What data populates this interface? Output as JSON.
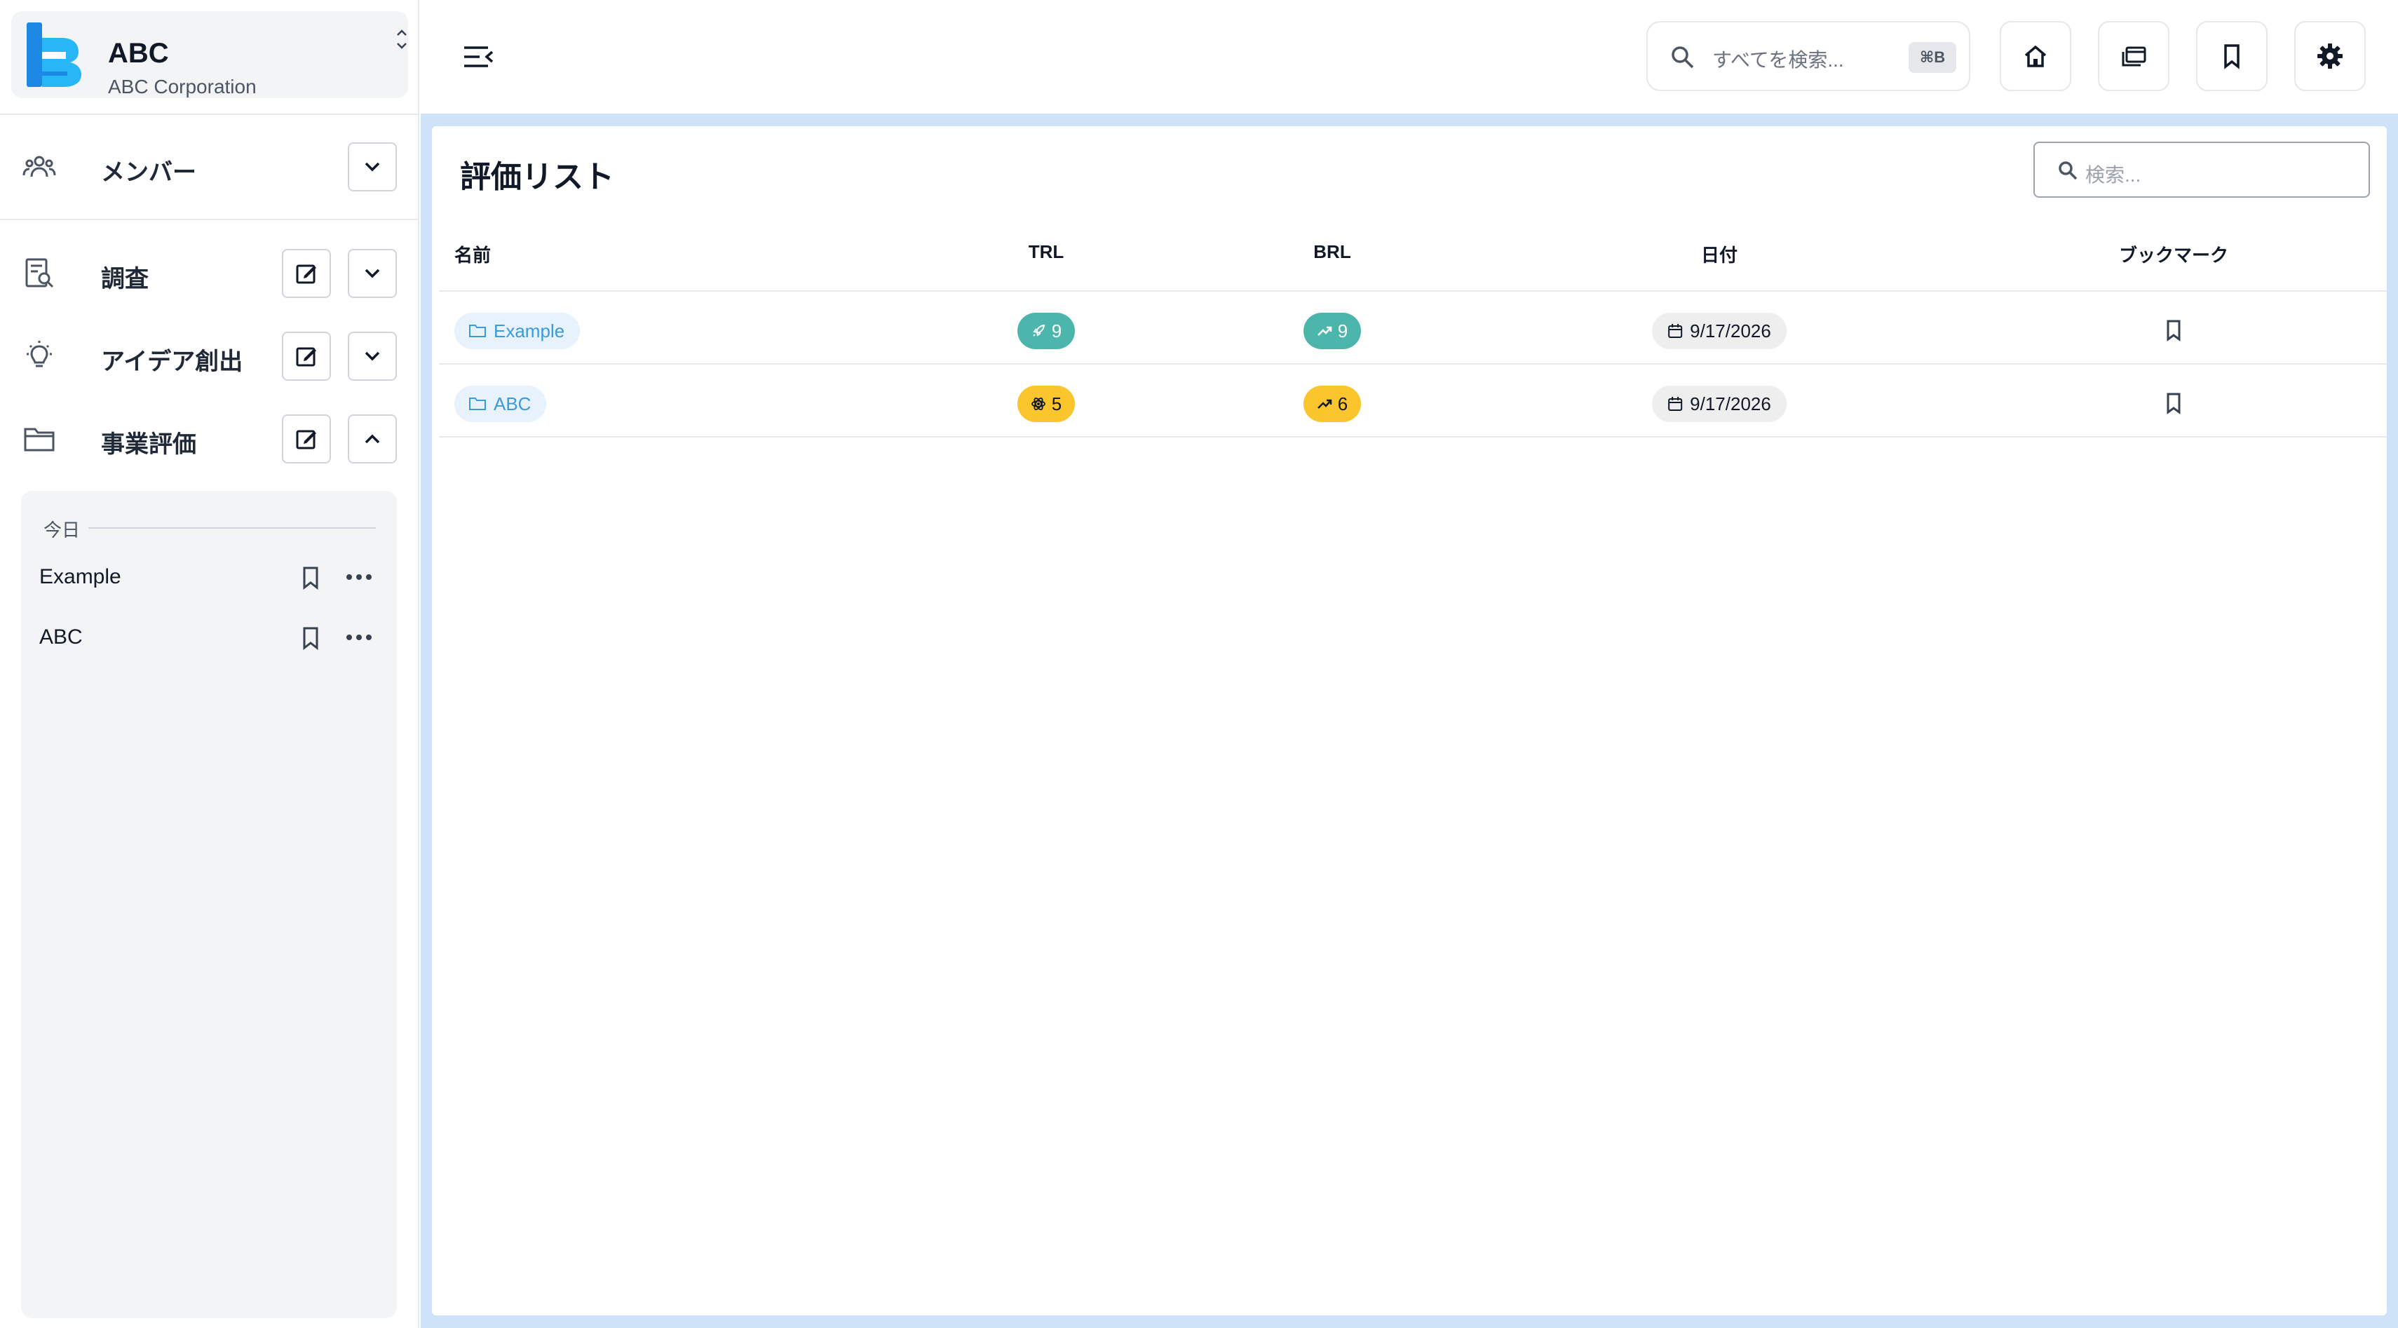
{
  "org": {
    "name": "ABC",
    "subtitle": "ABC Corporation",
    "logo_color": "#1e88e5"
  },
  "sidebar": {
    "items": [
      {
        "label": "メンバー",
        "icon": "people-icon",
        "has_edit": false,
        "expanded": false
      },
      {
        "label": "調査",
        "icon": "research-icon",
        "has_edit": true,
        "expanded": false
      },
      {
        "label": "アイデア創出",
        "icon": "lightbulb-icon",
        "has_edit": true,
        "expanded": false
      },
      {
        "label": "事業評価",
        "icon": "folder-icon",
        "has_edit": true,
        "expanded": true
      }
    ],
    "history": {
      "group_label": "今日",
      "items": [
        {
          "label": "Example"
        },
        {
          "label": "ABC"
        }
      ]
    }
  },
  "header": {
    "search_placeholder": "すべてを検索...",
    "search_shortcut": "⌘B",
    "buttons": [
      "home-icon",
      "stack-icon",
      "bookmark-icon",
      "settings-icon"
    ]
  },
  "main": {
    "title": "評価リスト",
    "search_placeholder": "検索...",
    "columns": {
      "name": "名前",
      "trl": "TRL",
      "brl": "BRL",
      "date": "日付",
      "bookmark": "ブックマーク"
    },
    "rows": [
      {
        "name": "Example",
        "trl": "9",
        "trl_icon": "rocket-icon",
        "trl_color": "#4db6ac",
        "brl": "9",
        "brl_icon": "trend-up-icon",
        "brl_color": "#4db6ac",
        "date": "9/17/2026"
      },
      {
        "name": "ABC",
        "trl": "5",
        "trl_icon": "atom-icon",
        "trl_color": "#fbc52d",
        "brl": "6",
        "brl_icon": "trend-up-icon",
        "brl_color": "#fbc52d",
        "date": "9/17/2026"
      }
    ]
  },
  "colors": {
    "accent_teal": "#4db6ac",
    "accent_amber": "#fbc52d",
    "folder_chip": "#3b9ad9",
    "main_bg": "#cfe3f8"
  }
}
